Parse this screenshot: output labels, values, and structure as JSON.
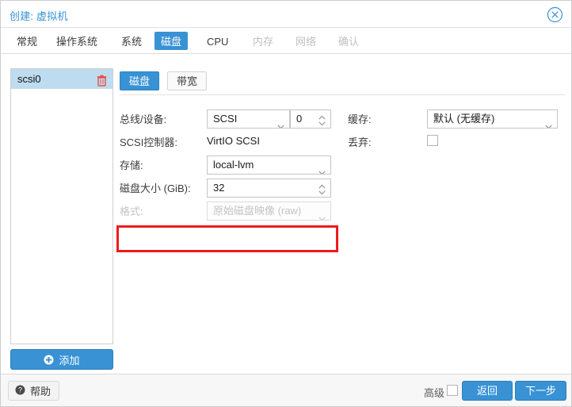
{
  "window": {
    "title": "创建: 虚拟机",
    "close_icon": "close-circle-icon"
  },
  "wizard_tabs": [
    {
      "label": "常规",
      "state": "enabled"
    },
    {
      "label": "操作系统",
      "state": "enabled"
    },
    {
      "label": "系统",
      "state": "enabled"
    },
    {
      "label": "磁盘",
      "state": "active"
    },
    {
      "label": "CPU",
      "state": "enabled"
    },
    {
      "label": "内存",
      "state": "disabled"
    },
    {
      "label": "网络",
      "state": "disabled"
    },
    {
      "label": "确认",
      "state": "disabled"
    }
  ],
  "disk_list": {
    "items": [
      {
        "label": "scsi0",
        "selected": true,
        "delete_icon": "trash-icon"
      }
    ],
    "add_label": "添加",
    "add_icon": "plus-circle-icon"
  },
  "subtabs": [
    {
      "label": "磁盘",
      "state": "active"
    },
    {
      "label": "带宽",
      "state": "enabled"
    }
  ],
  "form": {
    "bus_device": {
      "label": "总线/设备:",
      "bus_value": "SCSI",
      "device_value": "0",
      "caret_icon": "chevron-down-icon",
      "spinner_icon": "spinner-updown-icon"
    },
    "scsi_controller": {
      "label": "SCSI控制器:",
      "value": "VirtIO SCSI"
    },
    "storage": {
      "label": "存储:",
      "value": "local-lvm",
      "caret_icon": "chevron-down-icon"
    },
    "disk_size": {
      "label": "磁盘大小 (GiB):",
      "value": "32",
      "spinner_icon": "spinner-updown-icon",
      "highlighted": true,
      "highlight_color": "#ee1b1b"
    },
    "format": {
      "label": "格式:",
      "value": "原始磁盘映像 (raw)",
      "caret_icon": "chevron-down-icon",
      "disabled": true
    },
    "cache": {
      "label": "缓存:",
      "value": "默认 (无缓存)",
      "caret_icon": "chevron-down-icon"
    },
    "discard": {
      "label": "丢弃:",
      "checked": false
    }
  },
  "footer": {
    "help_label": "帮助",
    "help_icon": "question-circle-icon",
    "advanced_label": "高级",
    "advanced_checked": false,
    "back_label": "返回",
    "next_label": "下一步"
  },
  "theme": {
    "accent": "#3892d4",
    "selection": "#bedcf0",
    "highlight": "#ee1b1b",
    "trash": "#f04a3f"
  }
}
